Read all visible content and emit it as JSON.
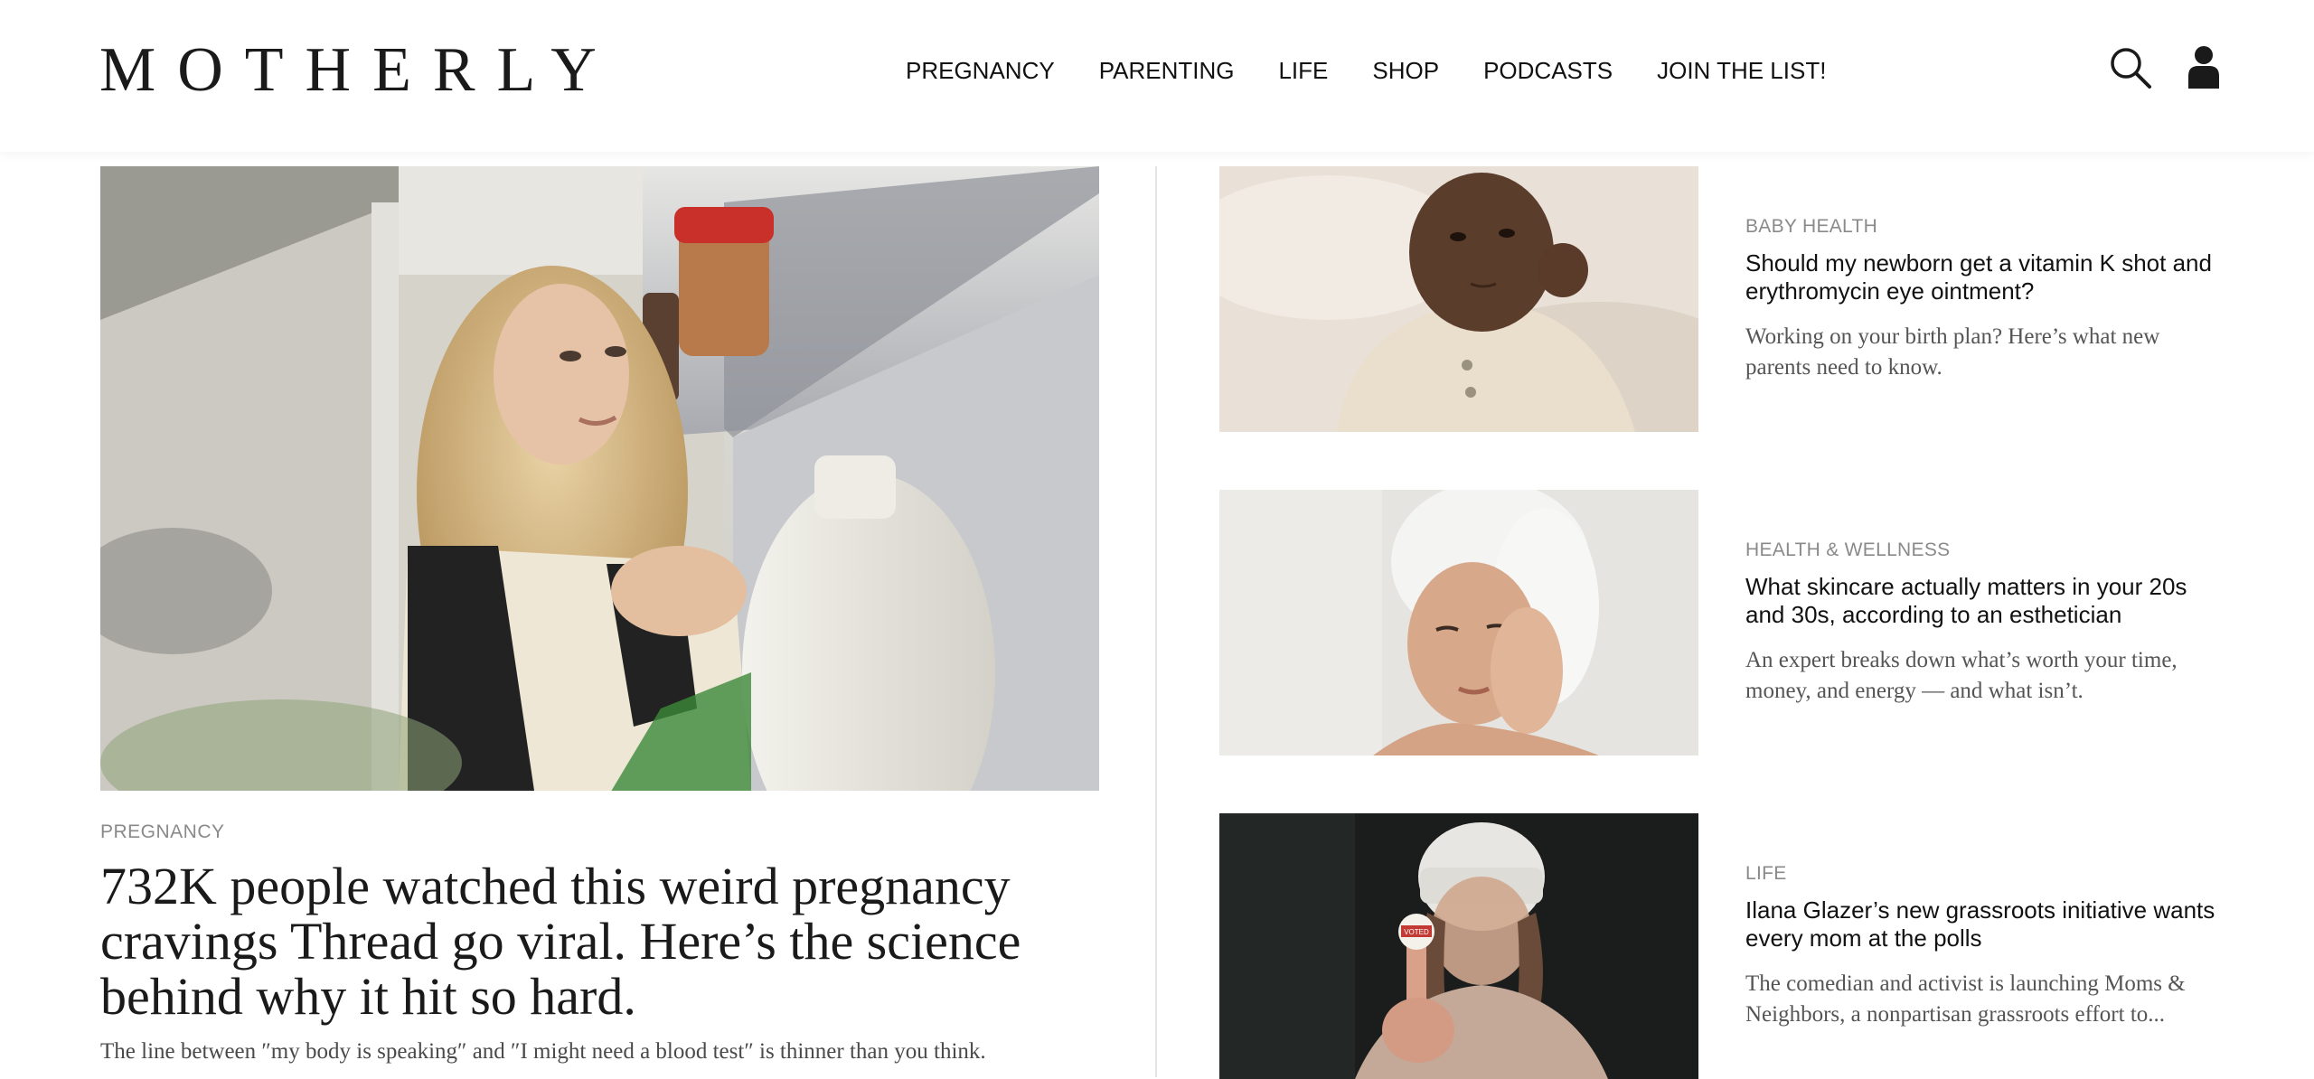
{
  "brand": {
    "logo": "MOTHERLY"
  },
  "nav": {
    "items": [
      {
        "label": "PREGNANCY"
      },
      {
        "label": "PARENTING"
      },
      {
        "label": "LIFE"
      },
      {
        "label": "SHOP"
      },
      {
        "label": "PODCASTS"
      },
      {
        "label": "JOIN THE LIST!"
      }
    ],
    "search_icon": "search-icon",
    "account_icon": "user-icon"
  },
  "feature": {
    "category": "PREGNANCY",
    "title": "732K people watched this weird pregnancy cravings Thread go viral. Here’s the science behind why it hit so hard.",
    "deck": "The line between ″my body is speaking″ and ″I might need a blood test″ is thinner than you think."
  },
  "cards": [
    {
      "category": "BABY HEALTH",
      "title": "Should my newborn get a vitamin K shot and erythromycin eye ointment?",
      "deck": "Working on your birth plan? Here’s what new parents need to know."
    },
    {
      "category": "HEALTH & WELLNESS",
      "title": "What skincare actually matters in your 20s and 30s, according to an esthetician",
      "deck": "An expert breaks down what’s worth your time, money, and energy — and what isn’t."
    },
    {
      "category": "LIFE",
      "title": "Ilana Glazer’s new grassroots initiative wants every mom at the polls",
      "deck": "The comedian and activist is launching Moms & Neighbors, a nonpartisan grassroots effort to..."
    }
  ],
  "sticker_text": "VOTED"
}
